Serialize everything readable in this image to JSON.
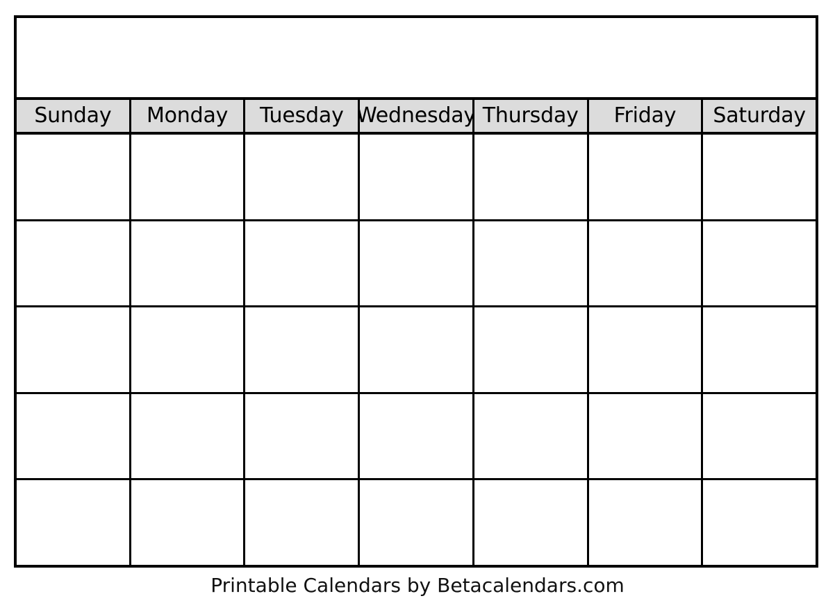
{
  "document": {
    "type": "blank-printable-monthly-calendar",
    "page_background": "#ffffff",
    "ink_color": "#000000",
    "header_background": "#dcdcdc"
  },
  "title_bar": {
    "month_year": "",
    "note": ""
  },
  "weekdays": [
    {
      "label": "Sunday"
    },
    {
      "label": "Monday"
    },
    {
      "label": "Tuesday"
    },
    {
      "label": "Wednesday"
    },
    {
      "label": "Thursday"
    },
    {
      "label": "Friday"
    },
    {
      "label": "Saturday"
    }
  ],
  "weeks": [
    {
      "days": [
        "",
        "",
        "",
        "",
        "",
        "",
        ""
      ]
    },
    {
      "days": [
        "",
        "",
        "",
        "",
        "",
        "",
        ""
      ]
    },
    {
      "days": [
        "",
        "",
        "",
        "",
        "",
        "",
        ""
      ]
    },
    {
      "days": [
        "",
        "",
        "",
        "",
        "",
        "",
        ""
      ]
    },
    {
      "days": [
        "",
        "",
        "",
        "",
        "",
        "",
        ""
      ]
    }
  ],
  "footer": {
    "credit": "Printable Calendars by Betacalendars.com"
  }
}
